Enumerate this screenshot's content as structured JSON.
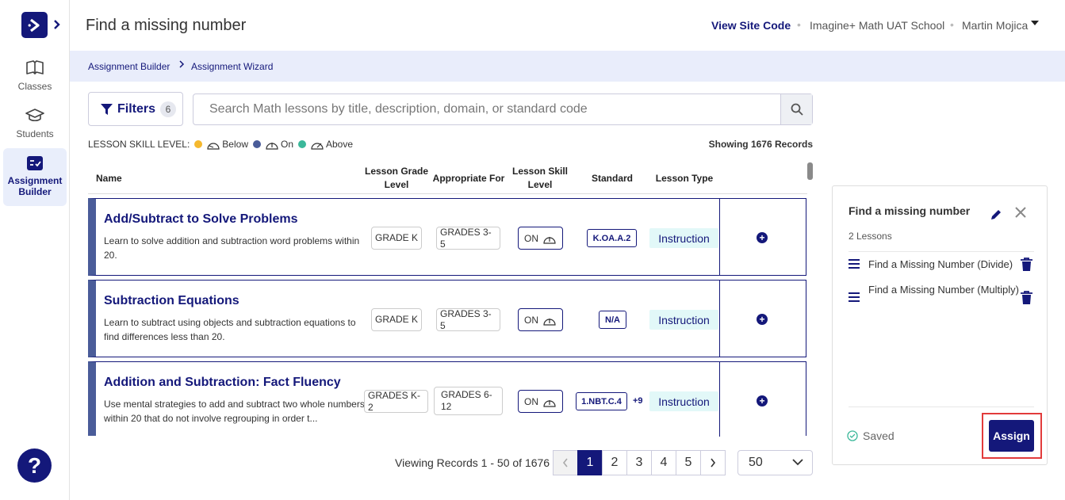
{
  "sidebar": {
    "items": [
      {
        "label": "Classes"
      },
      {
        "label": "Students"
      },
      {
        "label": "Assignment Builder"
      }
    ],
    "help_label": "?"
  },
  "header": {
    "title": "Find a missing number",
    "site_code": "View Site Code",
    "school": "Imagine+ Math UAT School",
    "user": "Martin  Mojica"
  },
  "breadcrumb": [
    "Assignment Builder",
    "Assignment Wizard"
  ],
  "filters": {
    "label": "Filters",
    "count": "6"
  },
  "search": {
    "placeholder": "Search Math lessons by title, description, domain, or standard code",
    "value": ""
  },
  "skill_legend": {
    "label": "LESSON SKILL LEVEL:",
    "items": [
      {
        "label": "Below",
        "color": "#f5b82e"
      },
      {
        "label": "On",
        "color": "#4a5c99"
      },
      {
        "label": "Above",
        "color": "#3bb89a"
      }
    ]
  },
  "records_label": "Showing 1676 Records",
  "table": {
    "headers": [
      "Name",
      "Lesson Grade Level",
      "Appropriate For",
      "Lesson Skill Level",
      "Standard",
      "Lesson Type"
    ],
    "rows": [
      {
        "title": "Add/Subtract to Solve Problems",
        "desc": "Learn to solve addition and subtraction word problems within 20.",
        "grade": "GRADE K",
        "appropriate": "GRADES 3-5",
        "skill": "ON",
        "standard": "K.OA.A.2",
        "more": "",
        "type": "Instruction"
      },
      {
        "title": "Subtraction Equations",
        "desc": "Learn to subtract using objects and subtraction equations to find differences less than 20.",
        "grade": "GRADE K",
        "appropriate": "GRADES 3-5",
        "skill": "ON",
        "standard": "N/A",
        "more": "",
        "type": "Instruction"
      },
      {
        "title": "Addition and Subtraction: Fact Fluency",
        "desc": "Use mental strategies to add and subtract two whole numbers within 20 that do not involve regrouping in order t...",
        "grade": "GRADES K-2",
        "appropriate": "GRADES 6-12",
        "skill": "ON",
        "standard": "1.NBT.C.4",
        "more": "+9",
        "type": "Instruction"
      }
    ]
  },
  "pagination": {
    "viewing": "Viewing Records 1 - 50 of 1676",
    "pages": [
      "1",
      "2",
      "3",
      "4",
      "5"
    ],
    "current": "1",
    "per_page": "50"
  },
  "panel": {
    "title": "Find a missing number",
    "subtitle": "2 Lessons",
    "lessons": [
      "Find a Missing Number (Divide)",
      "Find a Missing Number (Multiply)"
    ],
    "saved": "Saved",
    "assign": "Assign"
  },
  "colors": {
    "brand": "#14187a",
    "highlight": "#e23b3b",
    "instruction_bg": "#e2f8f8"
  }
}
